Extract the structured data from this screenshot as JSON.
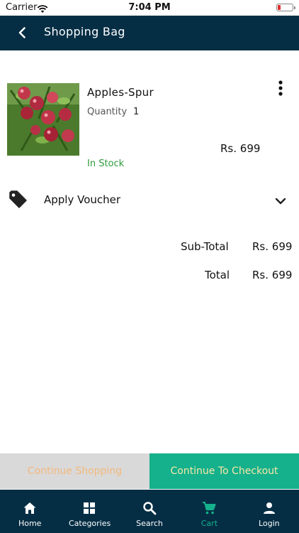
{
  "status_bar": {
    "carrier": "Carrier",
    "time": "7:04 PM"
  },
  "header": {
    "title": "Shopping Bag"
  },
  "cart_item": {
    "name": "Apples-Spur",
    "quantity_label": "Quantity",
    "quantity": "1",
    "price": "Rs. 699",
    "stock": "In Stock"
  },
  "voucher": {
    "label": "Apply Voucher"
  },
  "summary": {
    "subtotal_label": "Sub-Total",
    "subtotal_value": "Rs. 699",
    "total_label": "Total",
    "total_value": "Rs. 699"
  },
  "actions": {
    "continue_label": "Continue Shopping",
    "checkout_label": "Continue To Checkout"
  },
  "nav": {
    "items": [
      {
        "label": "Home",
        "icon": "home-icon"
      },
      {
        "label": "Categories",
        "icon": "grid-icon"
      },
      {
        "label": "Search",
        "icon": "search-icon"
      },
      {
        "label": "Cart",
        "icon": "cart-icon",
        "active": true
      },
      {
        "label": "Login",
        "icon": "person-icon"
      }
    ]
  },
  "colors": {
    "header_bg": "#052e45",
    "accent": "#14b18c",
    "in_stock": "#2e9b3a",
    "continue_bg": "#d9d9d9",
    "continue_text": "#f3b87c",
    "checkout_text": "#f8e6a6"
  }
}
